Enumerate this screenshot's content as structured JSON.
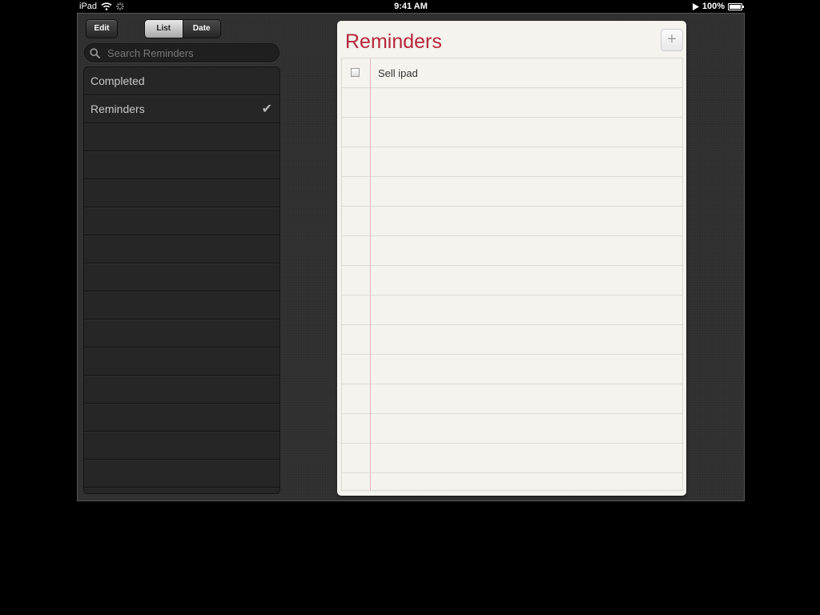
{
  "status_bar": {
    "device": "iPad",
    "time": "9:41 AM",
    "battery": "100%",
    "icons": [
      "wifi-icon",
      "activity-spinner-icon",
      "play-icon",
      "battery-icon"
    ]
  },
  "toolbar": {
    "edit_label": "Edit",
    "segments": [
      {
        "label": "List",
        "selected": true
      },
      {
        "label": "Date",
        "selected": false
      }
    ]
  },
  "search": {
    "placeholder": "Search Reminders",
    "value": ""
  },
  "lists": [
    {
      "label": "Completed",
      "checked": false
    },
    {
      "label": "Reminders",
      "checked": true
    }
  ],
  "list_check_glyph": "✔",
  "paper": {
    "title": "Reminders",
    "add_label": "+",
    "items": [
      {
        "text": "Sell ipad",
        "done": false
      }
    ]
  },
  "colors": {
    "title_red": "#b7263b",
    "paper": "#f4f3ee",
    "background": "#2e2e2e",
    "margin_line": "#eab5bd"
  }
}
